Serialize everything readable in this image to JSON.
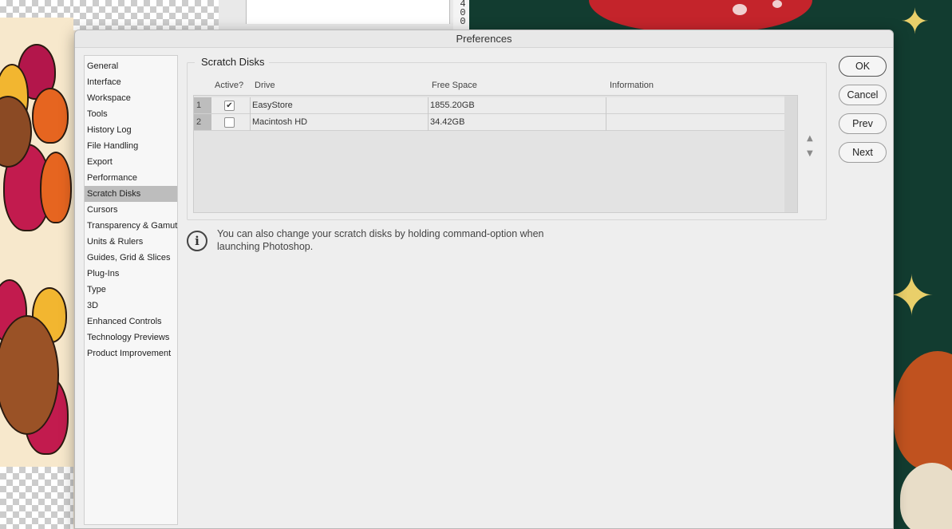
{
  "window": {
    "title": "Preferences"
  },
  "background": {
    "ruler_digits": [
      "4",
      "0",
      "0"
    ]
  },
  "sidebar": {
    "items": [
      {
        "label": "General"
      },
      {
        "label": "Interface"
      },
      {
        "label": "Workspace"
      },
      {
        "label": "Tools"
      },
      {
        "label": "History Log"
      },
      {
        "label": "File Handling"
      },
      {
        "label": "Export"
      },
      {
        "label": "Performance"
      },
      {
        "label": "Scratch Disks",
        "selected": true
      },
      {
        "label": "Cursors"
      },
      {
        "label": "Transparency & Gamut"
      },
      {
        "label": "Units & Rulers"
      },
      {
        "label": "Guides, Grid & Slices"
      },
      {
        "label": "Plug-Ins"
      },
      {
        "label": "Type"
      },
      {
        "label": "3D"
      },
      {
        "label": "Enhanced Controls"
      },
      {
        "label": "Technology Previews"
      },
      {
        "label": "Product Improvement"
      }
    ]
  },
  "scratch_disks": {
    "group_title": "Scratch Disks",
    "columns": {
      "active": "Active?",
      "drive": "Drive",
      "free_space": "Free Space",
      "information": "Information"
    },
    "rows": [
      {
        "num": "1",
        "active": true,
        "drive": "EasyStore",
        "free_space": "1855.20GB",
        "information": ""
      },
      {
        "num": "2",
        "active": false,
        "drive": "Macintosh HD",
        "free_space": "34.42GB",
        "information": ""
      }
    ],
    "move_up_icon": "triangle-up",
    "move_down_icon": "triangle-down"
  },
  "info": {
    "icon": "info-circle",
    "text": "You can also change your scratch disks by holding command-option when launching Photoshop."
  },
  "buttons": {
    "ok": "OK",
    "cancel": "Cancel",
    "prev": "Prev",
    "next": "Next"
  }
}
